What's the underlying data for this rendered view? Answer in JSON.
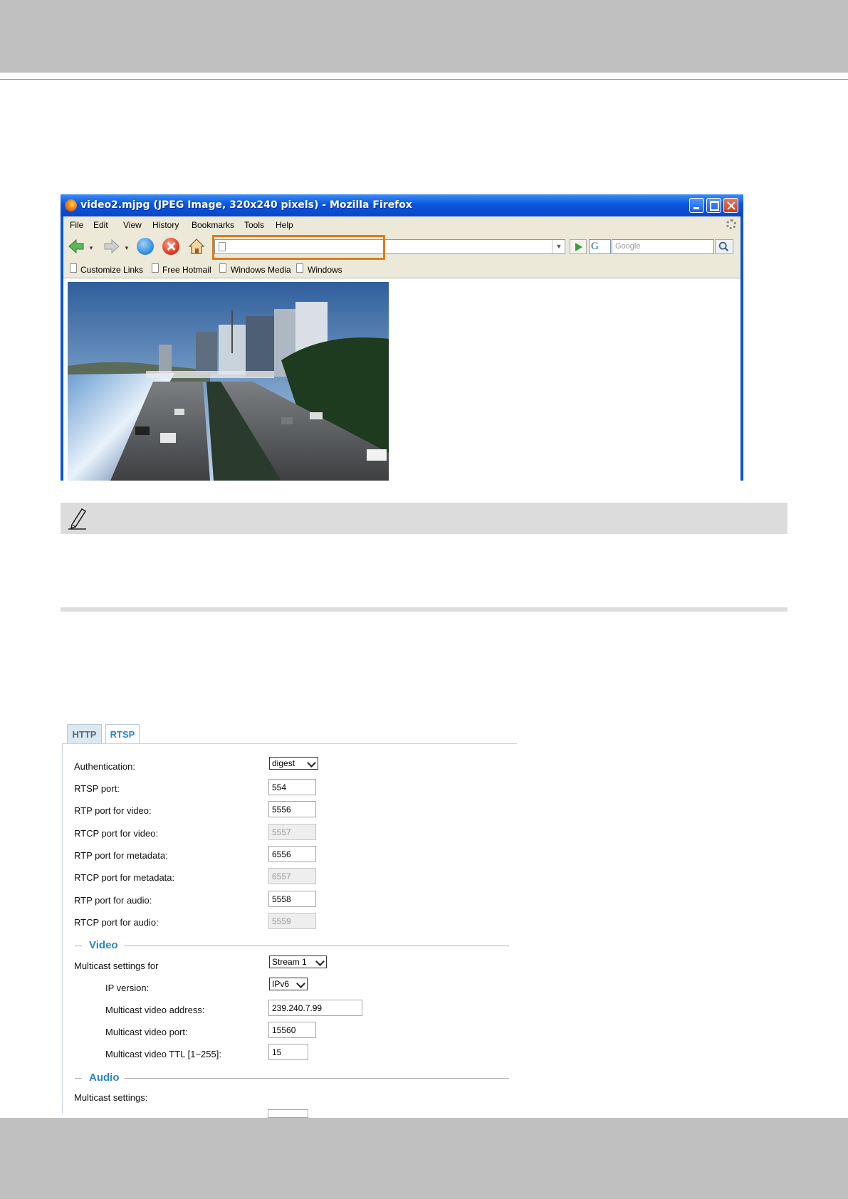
{
  "browser": {
    "title": "video2.mjpg (JPEG Image, 320x240 pixels) - Mozilla Firefox",
    "menu": [
      "File",
      "Edit",
      "View",
      "History",
      "Bookmarks",
      "Tools",
      "Help"
    ],
    "url_value": "",
    "search_placeholder": "Google",
    "search_engine": "G",
    "bookmarks": [
      "Customize Links",
      "Free Hotmail",
      "Windows Media",
      "Windows"
    ],
    "highlight_color": "#e07a1a"
  },
  "tabs": {
    "http": "HTTP",
    "rtsp": "RTSP",
    "active": "RTSP"
  },
  "rtsp": {
    "authentication_label": "Authentication:",
    "authentication_value": "digest",
    "rtsp_port_label": "RTSP port:",
    "rtsp_port_value": "554",
    "rtp_video_label": "RTP port for video:",
    "rtp_video_value": "5556",
    "rtcp_video_label": "RTCP port for video:",
    "rtcp_video_value": "5557",
    "rtp_metadata_label": "RTP port for metadata:",
    "rtp_metadata_value": "6556",
    "rtcp_metadata_label": "RTCP port for metadata:",
    "rtcp_metadata_value": "6557",
    "rtp_audio_label": "RTP port for audio:",
    "rtp_audio_value": "5558",
    "rtcp_audio_label": "RTCP port for audio:",
    "rtcp_audio_value": "5559"
  },
  "video": {
    "heading": "Video",
    "multicast_for_label": "Multicast settings for",
    "multicast_for_value": "Stream 1",
    "ip_version_label": "IP version:",
    "ip_version_value": "IPv6",
    "address_label": "Multicast video address:",
    "address_value": "239.240.7.99",
    "port_label": "Multicast video port:",
    "port_value": "15560",
    "ttl_label": "Multicast video TTL [1~255]:",
    "ttl_value": "15"
  },
  "audio": {
    "heading": "Audio",
    "multicast_label": "Multicast settings:"
  },
  "colors": {
    "accent": "#2c86c5",
    "page_band": "#c0c0c0",
    "note_bar": "#dcdcdc"
  }
}
